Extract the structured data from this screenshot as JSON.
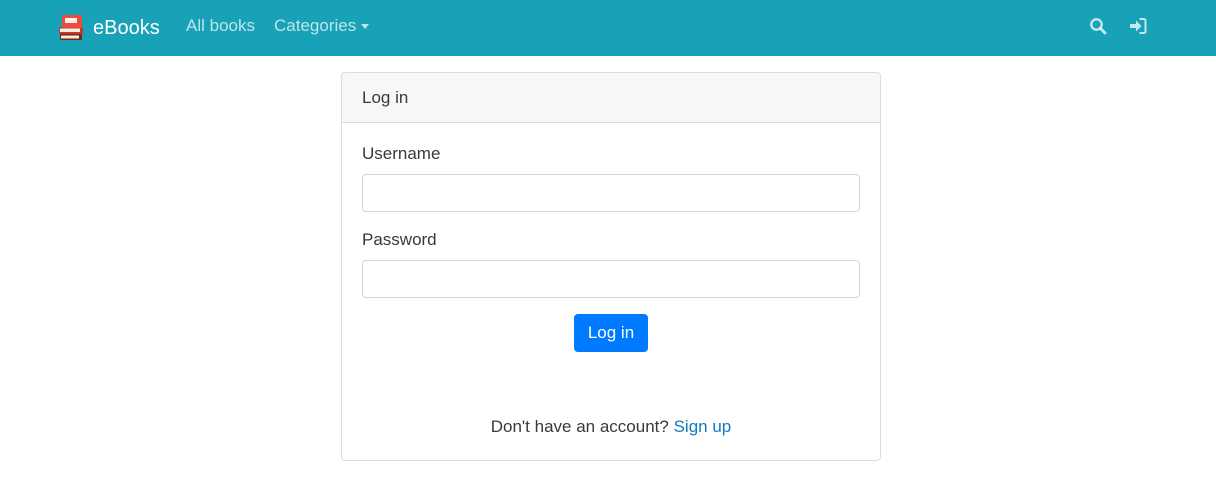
{
  "navbar": {
    "brand": "eBooks",
    "brand_icon": "book-stack-icon",
    "links": {
      "all_books": "All books",
      "categories": "Categories"
    },
    "icons": [
      "search-icon",
      "sign-in-icon"
    ],
    "background_color": "#17a2b8"
  },
  "login_card": {
    "title": "Log in",
    "username_label": "Username",
    "username_value": "",
    "password_label": "Password",
    "password_value": "",
    "submit_label": "Log in",
    "signup_prompt": "Don't have an account?",
    "signup_link": "Sign up",
    "accent_color": "#007bff"
  }
}
